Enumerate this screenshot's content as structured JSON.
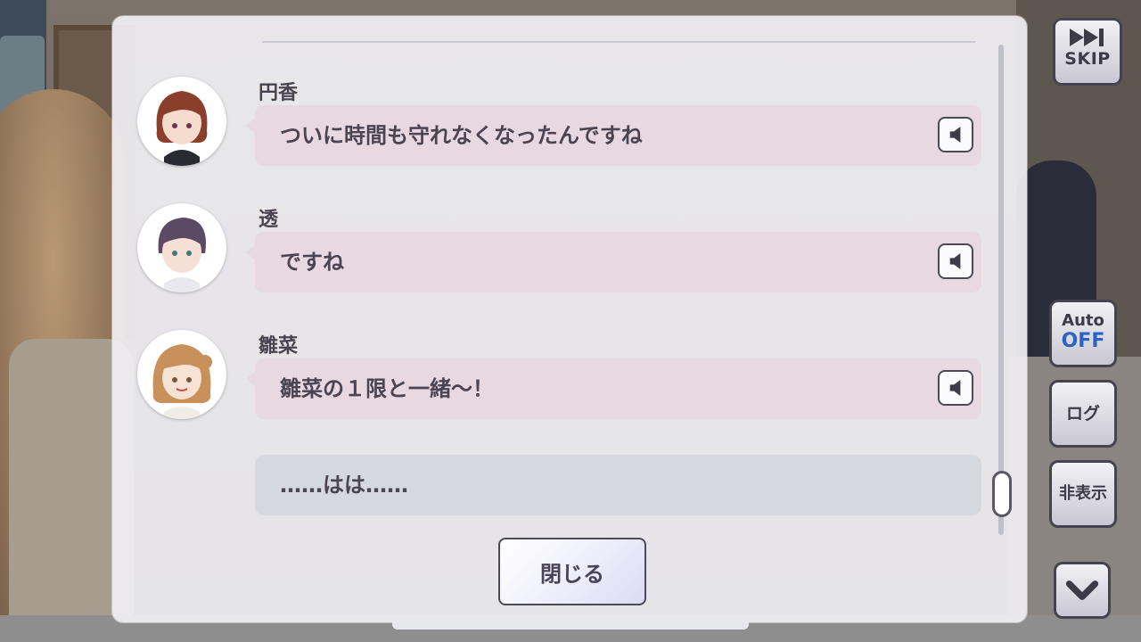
{
  "dialogue_log": {
    "entries": [
      {
        "speaker": "円香",
        "text": "ついに時間も守れなくなったんですね"
      },
      {
        "speaker": "透",
        "text": "ですね"
      },
      {
        "speaker": "雛菜",
        "text": "雛菜の１限と一緒～！"
      },
      {
        "speaker": "",
        "text": "……はは……"
      }
    ],
    "close_label": "閉じる"
  },
  "controls": {
    "skip_label": "SKIP",
    "auto_label": "Auto",
    "auto_state": "OFF",
    "log_label": "ログ",
    "hide_label": "非表示"
  },
  "icons": {
    "voice": "speaker-icon",
    "skip": "fast-forward-icon",
    "down": "chevron-down-icon"
  },
  "colors": {
    "bubble_character": "#e8d8e2",
    "bubble_narration": "#d6d8df",
    "auto_off": "#2b63c4"
  }
}
